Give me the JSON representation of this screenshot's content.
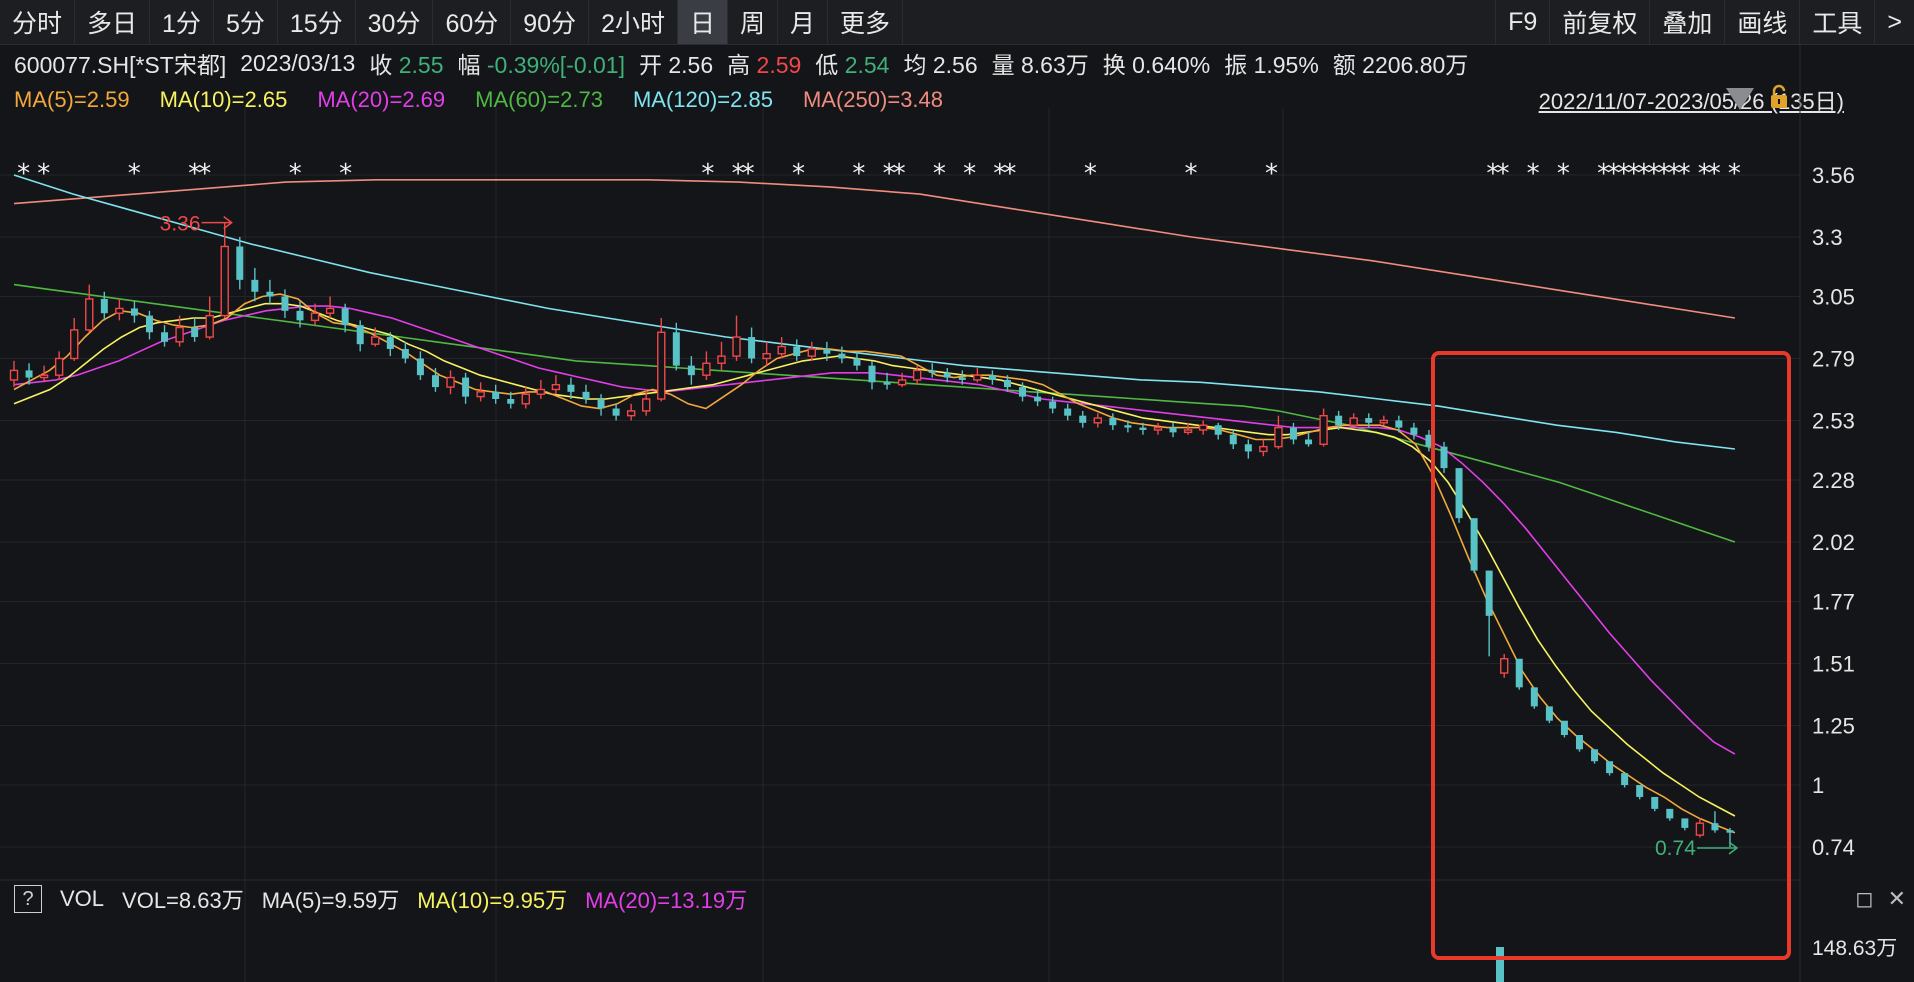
{
  "toolbar": {
    "periods": [
      "分时",
      "多日",
      "1分",
      "5分",
      "15分",
      "30分",
      "60分",
      "90分",
      "2小时",
      "日",
      "周",
      "月",
      "更多"
    ],
    "active_period": "日",
    "right_buttons": [
      "F9",
      "前复权",
      "叠加",
      "画线",
      "工具",
      ">"
    ]
  },
  "info": {
    "code_name": "600077.SH[*ST宋都]",
    "date": "2023/03/13",
    "close_label": "收",
    "close_value": "2.55",
    "change_label": "幅",
    "change_value": "-0.39%[-0.01]",
    "open_label": "开",
    "open_value": "2.56",
    "high_label": "高",
    "high_value": "2.59",
    "low_label": "低",
    "low_value": "2.54",
    "avg_label": "均",
    "avg_value": "2.56",
    "volume_label": "量",
    "volume_value": "8.63万",
    "turnover_label": "换",
    "turnover_value": "0.640%",
    "amplitude_label": "振",
    "amplitude_value": "1.95%",
    "amount_label": "额",
    "amount_value": "2206.80万"
  },
  "ma_legend": [
    {
      "text": "MA(5)=2.59",
      "color": "#f2a93b"
    },
    {
      "text": "MA(10)=2.65",
      "color": "#f7f260"
    },
    {
      "text": "MA(20)=2.69",
      "color": "#e23ee8"
    },
    {
      "text": "MA(60)=2.73",
      "color": "#4fb843"
    },
    {
      "text": "MA(120)=2.85",
      "color": "#7fe3f0"
    },
    {
      "text": "MA(250)=3.48",
      "color": "#f08c7e"
    }
  ],
  "range_text": "2022/11/07-2023/05/26 (135日)",
  "volume_legend": {
    "help": "?",
    "title": "VOL",
    "vol": "VOL=8.63万",
    "ma5": "MA(5)=9.59万",
    "ma10": "MA(10)=9.95万",
    "ma20": "MA(20)=13.19万",
    "ma5_color": "#e6e6e6",
    "ma10_color": "#f7f260",
    "ma20_color": "#e23ee8"
  },
  "window_icons": [
    "restore-icon",
    "close-icon"
  ],
  "chart_data": {
    "type": "candlestick",
    "y_ticks": [
      "3.56",
      "3.3",
      "3.05",
      "2.79",
      "2.53",
      "2.28",
      "2.02",
      "1.77",
      "1.51",
      "1.25",
      "1",
      "0.74"
    ],
    "ylim": [
      0.66,
      3.62
    ],
    "volume_axis_label": "148.63万",
    "high_marker": {
      "value": "3.36",
      "index": 13
    },
    "low_marker": {
      "value": "0.74",
      "index": 130
    },
    "star_indices": [
      1,
      3,
      12,
      18,
      19,
      28,
      33,
      69,
      72,
      73,
      78,
      84,
      87,
      88,
      92,
      95,
      98,
      99,
      107,
      117,
      125,
      147,
      148,
      151,
      154,
      158,
      159,
      160,
      161,
      162,
      163,
      164,
      165,
      166,
      168,
      169,
      171
    ],
    "candles": [
      [
        2.7,
        2.74,
        2.78,
        2.67,
        "up"
      ],
      [
        2.74,
        2.71,
        2.77,
        2.68,
        "down"
      ],
      [
        2.71,
        2.72,
        2.76,
        2.69,
        "up"
      ],
      [
        2.72,
        2.79,
        2.82,
        2.7,
        "up"
      ],
      [
        2.79,
        2.91,
        2.96,
        2.78,
        "up"
      ],
      [
        2.91,
        3.04,
        3.1,
        2.9,
        "up"
      ],
      [
        3.04,
        2.98,
        3.07,
        2.95,
        "down"
      ],
      [
        2.98,
        3.0,
        3.04,
        2.95,
        "up"
      ],
      [
        3.0,
        2.97,
        3.03,
        2.94,
        "down"
      ],
      [
        2.97,
        2.9,
        2.99,
        2.87,
        "down"
      ],
      [
        2.9,
        2.86,
        2.93,
        2.84,
        "down"
      ],
      [
        2.86,
        2.92,
        2.97,
        2.84,
        "up"
      ],
      [
        2.92,
        2.88,
        2.96,
        2.86,
        "down"
      ],
      [
        2.88,
        2.97,
        3.05,
        2.87,
        "up"
      ],
      [
        2.97,
        3.26,
        3.36,
        2.96,
        "up"
      ],
      [
        3.26,
        3.12,
        3.3,
        3.08,
        "down"
      ],
      [
        3.12,
        3.07,
        3.17,
        3.03,
        "down"
      ],
      [
        3.07,
        3.05,
        3.12,
        3.02,
        "down"
      ],
      [
        3.05,
        2.99,
        3.08,
        2.96,
        "down"
      ],
      [
        2.99,
        2.95,
        3.03,
        2.92,
        "down"
      ],
      [
        2.95,
        2.98,
        3.02,
        2.93,
        "up"
      ],
      [
        2.98,
        3.0,
        3.05,
        2.96,
        "up"
      ],
      [
        3.0,
        2.93,
        3.02,
        2.9,
        "down"
      ],
      [
        2.93,
        2.85,
        2.95,
        2.82,
        "down"
      ],
      [
        2.85,
        2.88,
        2.92,
        2.84,
        "up"
      ],
      [
        2.88,
        2.83,
        2.9,
        2.8,
        "down"
      ],
      [
        2.83,
        2.79,
        2.86,
        2.77,
        "down"
      ],
      [
        2.79,
        2.72,
        2.82,
        2.7,
        "down"
      ],
      [
        2.72,
        2.67,
        2.75,
        2.65,
        "down"
      ],
      [
        2.67,
        2.71,
        2.74,
        2.64,
        "up"
      ],
      [
        2.71,
        2.63,
        2.73,
        2.6,
        "down"
      ],
      [
        2.63,
        2.65,
        2.69,
        2.61,
        "up"
      ],
      [
        2.65,
        2.62,
        2.68,
        2.6,
        "down"
      ],
      [
        2.62,
        2.6,
        2.65,
        2.58,
        "down"
      ],
      [
        2.6,
        2.64,
        2.67,
        2.58,
        "up"
      ],
      [
        2.64,
        2.66,
        2.7,
        2.62,
        "up"
      ],
      [
        2.66,
        2.68,
        2.72,
        2.64,
        "up"
      ],
      [
        2.68,
        2.65,
        2.71,
        2.62,
        "down"
      ],
      [
        2.65,
        2.62,
        2.68,
        2.6,
        "down"
      ],
      [
        2.62,
        2.58,
        2.64,
        2.55,
        "down"
      ],
      [
        2.58,
        2.55,
        2.6,
        2.53,
        "down"
      ],
      [
        2.55,
        2.57,
        2.6,
        2.53,
        "up"
      ],
      [
        2.57,
        2.62,
        2.66,
        2.55,
        "up"
      ],
      [
        2.62,
        2.9,
        2.96,
        2.61,
        "up"
      ],
      [
        2.9,
        2.76,
        2.94,
        2.74,
        "down"
      ],
      [
        2.76,
        2.72,
        2.8,
        2.68,
        "down"
      ],
      [
        2.72,
        2.77,
        2.82,
        2.7,
        "up"
      ],
      [
        2.77,
        2.8,
        2.86,
        2.74,
        "up"
      ],
      [
        2.8,
        2.88,
        2.97,
        2.78,
        "up"
      ],
      [
        2.88,
        2.79,
        2.92,
        2.77,
        "down"
      ],
      [
        2.79,
        2.81,
        2.86,
        2.76,
        "up"
      ],
      [
        2.81,
        2.84,
        2.88,
        2.79,
        "up"
      ],
      [
        2.84,
        2.8,
        2.87,
        2.78,
        "down"
      ],
      [
        2.8,
        2.83,
        2.86,
        2.78,
        "up"
      ],
      [
        2.83,
        2.81,
        2.86,
        2.78,
        "down"
      ],
      [
        2.81,
        2.79,
        2.84,
        2.77,
        "down"
      ],
      [
        2.79,
        2.76,
        2.82,
        2.74,
        "down"
      ],
      [
        2.76,
        2.69,
        2.78,
        2.66,
        "down"
      ],
      [
        2.69,
        2.68,
        2.73,
        2.66,
        "down"
      ],
      [
        2.68,
        2.7,
        2.73,
        2.67,
        "up"
      ],
      [
        2.7,
        2.74,
        2.76,
        2.68,
        "up"
      ],
      [
        2.74,
        2.73,
        2.77,
        2.71,
        "down"
      ],
      [
        2.73,
        2.71,
        2.75,
        2.69,
        "down"
      ],
      [
        2.71,
        2.7,
        2.74,
        2.68,
        "down"
      ],
      [
        2.7,
        2.72,
        2.75,
        2.69,
        "up"
      ],
      [
        2.72,
        2.7,
        2.74,
        2.68,
        "down"
      ],
      [
        2.7,
        2.67,
        2.72,
        2.65,
        "down"
      ],
      [
        2.67,
        2.63,
        2.69,
        2.61,
        "down"
      ],
      [
        2.63,
        2.61,
        2.66,
        2.59,
        "down"
      ],
      [
        2.61,
        2.58,
        2.63,
        2.56,
        "down"
      ],
      [
        2.58,
        2.55,
        2.6,
        2.53,
        "down"
      ],
      [
        2.55,
        2.52,
        2.57,
        2.5,
        "down"
      ],
      [
        2.52,
        2.54,
        2.56,
        2.5,
        "up"
      ],
      [
        2.54,
        2.51,
        2.56,
        2.49,
        "down"
      ],
      [
        2.51,
        2.5,
        2.53,
        2.48,
        "down"
      ],
      [
        2.5,
        2.49,
        2.52,
        2.47,
        "down"
      ],
      [
        2.49,
        2.5,
        2.52,
        2.47,
        "up"
      ],
      [
        2.5,
        2.48,
        2.52,
        2.46,
        "down"
      ],
      [
        2.48,
        2.49,
        2.52,
        2.47,
        "up"
      ],
      [
        2.49,
        2.51,
        2.53,
        2.47,
        "up"
      ],
      [
        2.51,
        2.47,
        2.52,
        2.45,
        "down"
      ],
      [
        2.47,
        2.43,
        2.49,
        2.41,
        "down"
      ],
      [
        2.43,
        2.4,
        2.45,
        2.37,
        "down"
      ],
      [
        2.4,
        2.42,
        2.45,
        2.38,
        "up"
      ],
      [
        2.42,
        2.5,
        2.55,
        2.41,
        "up"
      ],
      [
        2.5,
        2.45,
        2.52,
        2.43,
        "down"
      ],
      [
        2.45,
        2.43,
        2.48,
        2.42,
        "down"
      ],
      [
        2.43,
        2.55,
        2.58,
        2.42,
        "up"
      ],
      [
        2.55,
        2.51,
        2.57,
        2.49,
        "down"
      ],
      [
        2.51,
        2.54,
        2.56,
        2.5,
        "up"
      ],
      [
        2.54,
        2.52,
        2.56,
        2.5,
        "down"
      ],
      [
        2.52,
        2.53,
        2.55,
        2.51,
        "up"
      ],
      [
        2.53,
        2.5,
        2.55,
        2.48,
        "down"
      ],
      [
        2.5,
        2.47,
        2.52,
        2.45,
        "down"
      ],
      [
        2.47,
        2.42,
        2.49,
        2.4,
        "down"
      ],
      [
        2.42,
        2.33,
        2.44,
        2.31,
        "down"
      ],
      [
        2.33,
        2.12,
        2.15,
        2.1,
        "down"
      ],
      [
        2.12,
        1.9,
        1.92,
        1.89,
        "down"
      ],
      [
        1.9,
        1.71,
        1.73,
        1.54,
        "down"
      ],
      [
        1.47,
        1.53,
        1.55,
        1.45,
        "up"
      ],
      [
        1.53,
        1.41,
        1.42,
        1.4,
        "down"
      ],
      [
        1.41,
        1.33,
        1.34,
        1.32,
        "down"
      ],
      [
        1.33,
        1.27,
        1.28,
        1.26,
        "down"
      ],
      [
        1.27,
        1.21,
        1.22,
        1.2,
        "down"
      ],
      [
        1.21,
        1.15,
        1.16,
        1.14,
        "down"
      ],
      [
        1.15,
        1.1,
        1.11,
        1.09,
        "down"
      ],
      [
        1.1,
        1.05,
        1.06,
        1.04,
        "down"
      ],
      [
        1.05,
        1.0,
        1.01,
        0.99,
        "down"
      ],
      [
        1.0,
        0.95,
        0.96,
        0.94,
        "down"
      ],
      [
        0.95,
        0.9,
        0.91,
        0.89,
        "down"
      ],
      [
        0.9,
        0.86,
        0.87,
        0.85,
        "down"
      ],
      [
        0.86,
        0.82,
        0.83,
        0.81,
        "down"
      ],
      [
        0.79,
        0.84,
        0.86,
        0.78,
        "up"
      ],
      [
        0.84,
        0.81,
        0.89,
        0.8,
        "down"
      ],
      [
        0.81,
        0.8,
        0.82,
        0.74,
        "down"
      ]
    ],
    "ma_series": {
      "ma5": [
        2.66,
        2.7,
        2.74,
        2.8,
        2.88,
        2.95,
        2.99,
        2.98,
        2.95,
        2.93,
        2.92,
        2.93,
        2.96,
        3.02,
        3.05,
        3.06,
        3.04,
        2.98,
        2.94,
        2.93,
        2.9,
        2.86,
        2.82,
        2.77,
        2.72,
        2.69,
        2.66,
        2.65,
        2.64,
        2.65,
        2.65,
        2.62,
        2.59,
        2.58,
        2.6,
        2.64,
        2.66,
        2.64,
        2.6,
        2.58,
        2.63,
        2.68,
        2.74,
        2.79,
        2.81,
        2.83,
        2.83,
        2.82,
        2.82,
        2.81,
        2.8,
        2.76,
        2.72,
        2.71,
        2.72,
        2.72,
        2.71,
        2.7,
        2.68,
        2.64,
        2.6,
        2.57,
        2.54,
        2.52,
        2.51,
        2.5,
        2.5,
        2.5,
        2.49,
        2.47,
        2.45,
        2.45,
        2.46,
        2.48,
        2.5,
        2.51,
        2.51,
        2.51,
        2.49,
        2.43,
        2.3,
        2.13,
        1.95,
        1.78,
        1.63,
        1.48,
        1.37,
        1.28,
        1.21,
        1.15,
        1.09,
        1.04,
        0.99,
        0.95,
        0.9,
        0.86,
        0.83,
        0.8
      ],
      "ma10": [
        2.6,
        2.63,
        2.66,
        2.71,
        2.77,
        2.83,
        2.88,
        2.92,
        2.94,
        2.95,
        2.96,
        2.96,
        2.98,
        3.0,
        3.02,
        3.02,
        3.01,
        2.98,
        2.95,
        2.93,
        2.91,
        2.89,
        2.85,
        2.82,
        2.78,
        2.75,
        2.72,
        2.7,
        2.68,
        2.66,
        2.64,
        2.63,
        2.62,
        2.62,
        2.63,
        2.64,
        2.65,
        2.66,
        2.67,
        2.68,
        2.7,
        2.72,
        2.74,
        2.76,
        2.78,
        2.79,
        2.8,
        2.79,
        2.78,
        2.76,
        2.75,
        2.74,
        2.73,
        2.72,
        2.71,
        2.7,
        2.68,
        2.66,
        2.64,
        2.62,
        2.6,
        2.58,
        2.56,
        2.54,
        2.53,
        2.52,
        2.51,
        2.5,
        2.49,
        2.48,
        2.47,
        2.47,
        2.48,
        2.49,
        2.5,
        2.49,
        2.48,
        2.46,
        2.42,
        2.36,
        2.27,
        2.15,
        2.02,
        1.88,
        1.74,
        1.61,
        1.5,
        1.4,
        1.31,
        1.24,
        1.17,
        1.11,
        1.05,
        1.0,
        0.95,
        0.91,
        0.87
      ],
      "ma20": [
        2.68,
        2.69,
        2.7,
        2.72,
        2.75,
        2.78,
        2.82,
        2.86,
        2.89,
        2.92,
        2.95,
        2.97,
        2.99,
        3.0,
        3.01,
        3.01,
        3.0,
        2.98,
        2.96,
        2.93,
        2.9,
        2.87,
        2.84,
        2.81,
        2.78,
        2.75,
        2.73,
        2.71,
        2.69,
        2.67,
        2.66,
        2.65,
        2.66,
        2.67,
        2.68,
        2.69,
        2.7,
        2.71,
        2.72,
        2.73,
        2.73,
        2.73,
        2.72,
        2.71,
        2.7,
        2.69,
        2.68,
        2.66,
        2.64,
        2.62,
        2.61,
        2.6,
        2.59,
        2.58,
        2.57,
        2.56,
        2.55,
        2.54,
        2.53,
        2.52,
        2.51,
        2.5,
        2.5,
        2.5,
        2.5,
        2.5,
        2.49,
        2.46,
        2.42,
        2.35,
        2.27,
        2.18,
        2.08,
        1.97,
        1.86,
        1.75,
        1.64,
        1.54,
        1.44,
        1.35,
        1.26,
        1.18,
        1.13
      ],
      "ma60": [
        3.1,
        3.08,
        3.06,
        3.04,
        3.02,
        3.0,
        2.98,
        2.96,
        2.94,
        2.92,
        2.9,
        2.88,
        2.86,
        2.84,
        2.82,
        2.8,
        2.78,
        2.77,
        2.76,
        2.75,
        2.74,
        2.73,
        2.72,
        2.71,
        2.7,
        2.69,
        2.68,
        2.67,
        2.66,
        2.65,
        2.64,
        2.63,
        2.62,
        2.61,
        2.6,
        2.59,
        2.57,
        2.54,
        2.51,
        2.47,
        2.43,
        2.39,
        2.35,
        2.31,
        2.27,
        2.22,
        2.17,
        2.12,
        2.07,
        2.02
      ],
      "ma120": [
        3.56,
        3.48,
        3.41,
        3.34,
        3.27,
        3.21,
        3.15,
        3.1,
        3.05,
        3.0,
        2.96,
        2.92,
        2.88,
        2.85,
        2.82,
        2.79,
        2.76,
        2.74,
        2.72,
        2.7,
        2.69,
        2.67,
        2.65,
        2.62,
        2.59,
        2.55,
        2.51,
        2.48,
        2.44,
        2.41
      ],
      "ma250": [
        3.44,
        3.47,
        3.5,
        3.53,
        3.54,
        3.54,
        3.54,
        3.54,
        3.53,
        3.51,
        3.48,
        3.42,
        3.36,
        3.3,
        3.25,
        3.2,
        3.14,
        3.08,
        3.02,
        2.96
      ]
    }
  }
}
